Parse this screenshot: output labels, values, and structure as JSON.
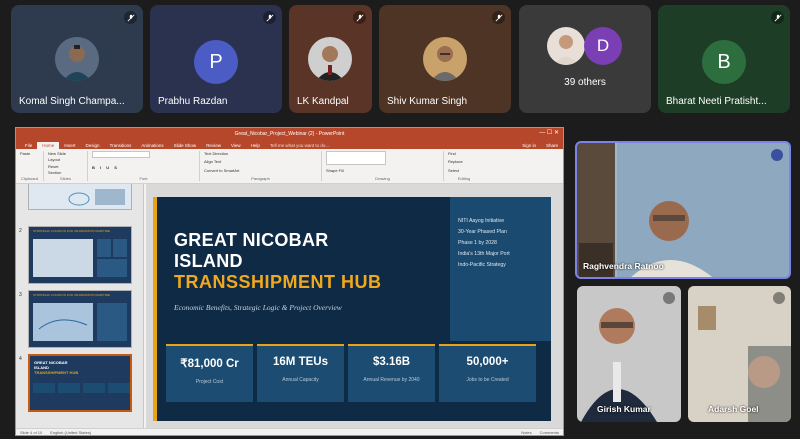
{
  "participants_top": [
    {
      "name": "Komal Singh Champa...",
      "type": "photo"
    },
    {
      "name": "Prabhu Razdan",
      "type": "letter",
      "letter": "P",
      "color": "#3f4fb8"
    },
    {
      "name": "LK Kandpal",
      "type": "photo"
    },
    {
      "name": "Shiv Kumar Singh",
      "type": "photo"
    },
    {
      "name": "39 others",
      "type": "group",
      "letter": "D"
    },
    {
      "name": "Bharat Neeti Pratisht...",
      "type": "letter",
      "letter": "B",
      "color": "#2e6b3c"
    }
  ],
  "ppt": {
    "window_title": "Great_Nicobar_Project_Webinar (2) - PowerPoint",
    "search_placeholder": "Tell me what you want to do...",
    "signin": "Sign in",
    "share": "Share",
    "tabs": [
      "File",
      "Home",
      "Insert",
      "Design",
      "Transitions",
      "Animations",
      "Slide Show",
      "Review",
      "View",
      "Help"
    ],
    "active_tab": "Home",
    "ribbon_groups": [
      "Clipboard",
      "Slides",
      "Font",
      "Paragraph",
      "Drawing",
      "Editing"
    ],
    "ribbon_buttons": {
      "paste": "Paste",
      "new_slide": "New Slide",
      "layout": "Layout",
      "reset": "Reset",
      "section": "Section",
      "text_direction": "Text Direction",
      "align_text": "Align Text",
      "convert_smartart": "Convert to SmartArt",
      "arrange": "Arrange",
      "quick_styles": "Quick Styles",
      "shape_fill": "Shape Fill",
      "shape_outline": "Shape Outline",
      "shape_effects": "Shape Effects",
      "find": "Find",
      "replace": "Replace",
      "select": "Select"
    },
    "thumbnails": [
      {
        "num": "",
        "title": ""
      },
      {
        "num": "2",
        "title": "STRATEGIC LOCATION FOR INFORMATION MARITIME"
      },
      {
        "num": "3",
        "title": "STRATEGIC LOCATION FOR INFORMATION MARITIME"
      },
      {
        "num": "4",
        "title": "GREAT NICOBAR ISLAND TRANSSHIPMENT HUB"
      }
    ],
    "status": {
      "slide": "Slide 4 of 10",
      "language": "English (United States)",
      "notes": "Notes",
      "comments": "Comments"
    }
  },
  "slide": {
    "title_line1": "GREAT NICOBAR",
    "title_line2": "ISLAND",
    "title_line3": "TRANSSHIPMENT HUB",
    "subtitle": "Economic Benefits, Strategic Logic & Project Overview",
    "side_lines": [
      "NITI Aayog Initiative",
      "30-Year Phased Plan",
      "Phase 1 by 2028",
      "India's 13th Major Port",
      "Indo-Pacific Strategy"
    ],
    "stats": [
      {
        "value": "₹81,000 Cr",
        "label": "Project Cost"
      },
      {
        "value": "16M TEUs",
        "label": "Annual Capacity"
      },
      {
        "value": "$3.16B",
        "label": "Annual Revenue by 2040"
      },
      {
        "value": "50,000+",
        "label": "Jobs to be Created"
      }
    ]
  },
  "video_tiles": [
    {
      "name": "Raghvendra Ratnoo"
    },
    {
      "name": "Girish Kumar"
    },
    {
      "name": "Adarsh Goel"
    }
  ],
  "colors": {
    "ppt_accent": "#b7472a",
    "slide_bg": "#0f2a45",
    "slide_gold": "#e8a317",
    "teams_bg": "#1c1c1c"
  }
}
